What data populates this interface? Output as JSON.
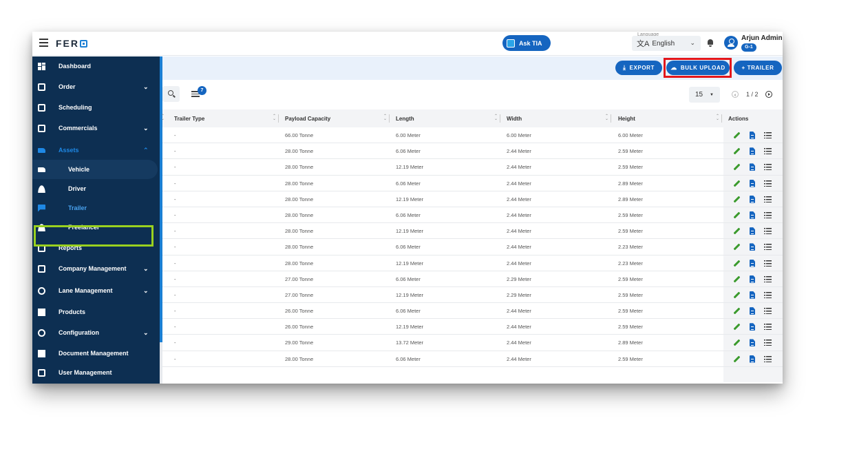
{
  "brand": {
    "logo_text": "FER"
  },
  "topbar": {
    "ask_tia_label": "Ask TIA",
    "language_label": "Language",
    "language_value": "English",
    "user_name": "Arjun Admin",
    "user_badge": "G-1"
  },
  "sidebar": {
    "items": [
      {
        "label": "Dashboard",
        "icon": "dashboard-icon"
      },
      {
        "label": "Order",
        "icon": "order-icon",
        "expandable": true
      },
      {
        "label": "Scheduling",
        "icon": "scheduling-icon"
      },
      {
        "label": "Commercials",
        "icon": "commercials-icon",
        "expandable": true
      },
      {
        "label": "Assets",
        "icon": "assets-icon",
        "expanded": true
      },
      {
        "label": "Vehicle",
        "icon": "truck-icon"
      },
      {
        "label": "Driver",
        "icon": "person-icon"
      },
      {
        "label": "Trailer",
        "icon": "trailer-icon",
        "selected": true
      },
      {
        "label": "Freelancer",
        "icon": "freelancer-icon"
      },
      {
        "label": "Reports",
        "icon": "reports-icon"
      },
      {
        "label": "Company Management",
        "icon": "company-icon",
        "expandable": true
      },
      {
        "label": "Lane Management",
        "icon": "lane-icon",
        "expandable": true
      },
      {
        "label": "Products",
        "icon": "products-icon"
      },
      {
        "label": "Configuration",
        "icon": "gear-icon",
        "expandable": true
      },
      {
        "label": "Document Management",
        "icon": "document-icon"
      },
      {
        "label": "User Management",
        "icon": "user-management-icon"
      }
    ]
  },
  "toolbar": {
    "export_label": "EXPORT",
    "bulk_upload_label": "BULK UPLOAD",
    "add_trailer_label": "+ TRAILER",
    "filter_count": "7",
    "page_size": "15",
    "pagination": "1 / 2"
  },
  "table": {
    "columns": [
      "Trailer Type",
      "Payload Capacity",
      "Length",
      "Width",
      "Height",
      "Actions"
    ],
    "rows": [
      [
        "-",
        "66.00 Tonne",
        "6.00 Meter",
        "6.00 Meter",
        "6.00 Meter"
      ],
      [
        "-",
        "28.00 Tonne",
        "6.06 Meter",
        "2.44 Meter",
        "2.59 Meter"
      ],
      [
        "-",
        "28.00 Tonne",
        "12.19 Meter",
        "2.44 Meter",
        "2.59 Meter"
      ],
      [
        "-",
        "28.00 Tonne",
        "6.06 Meter",
        "2.44 Meter",
        "2.89 Meter"
      ],
      [
        "-",
        "28.00 Tonne",
        "12.19 Meter",
        "2.44 Meter",
        "2.89 Meter"
      ],
      [
        "-",
        "28.00 Tonne",
        "6.06 Meter",
        "2.44 Meter",
        "2.59 Meter"
      ],
      [
        "-",
        "28.00 Tonne",
        "12.19 Meter",
        "2.44 Meter",
        "2.59 Meter"
      ],
      [
        "-",
        "28.00 Tonne",
        "6.06 Meter",
        "2.44 Meter",
        "2.23 Meter"
      ],
      [
        "-",
        "28.00 Tonne",
        "12.19 Meter",
        "2.44 Meter",
        "2.23 Meter"
      ],
      [
        "-",
        "27.00 Tonne",
        "6.06 Meter",
        "2.29 Meter",
        "2.59 Meter"
      ],
      [
        "-",
        "27.00 Tonne",
        "12.19 Meter",
        "2.29 Meter",
        "2.59 Meter"
      ],
      [
        "-",
        "26.00 Tonne",
        "6.06 Meter",
        "2.44 Meter",
        "2.59 Meter"
      ],
      [
        "-",
        "26.00 Tonne",
        "12.19 Meter",
        "2.44 Meter",
        "2.59 Meter"
      ],
      [
        "-",
        "29.00 Tonne",
        "13.72 Meter",
        "2.44 Meter",
        "2.89 Meter"
      ],
      [
        "-",
        "28.00 Tonne",
        "6.06 Meter",
        "2.44 Meter",
        "2.59 Meter"
      ]
    ]
  },
  "colors": {
    "sidebar": "#0d2f52",
    "primary": "#1565c0",
    "highlight_green": "#9ad11f",
    "highlight_red": "#e3161b"
  }
}
